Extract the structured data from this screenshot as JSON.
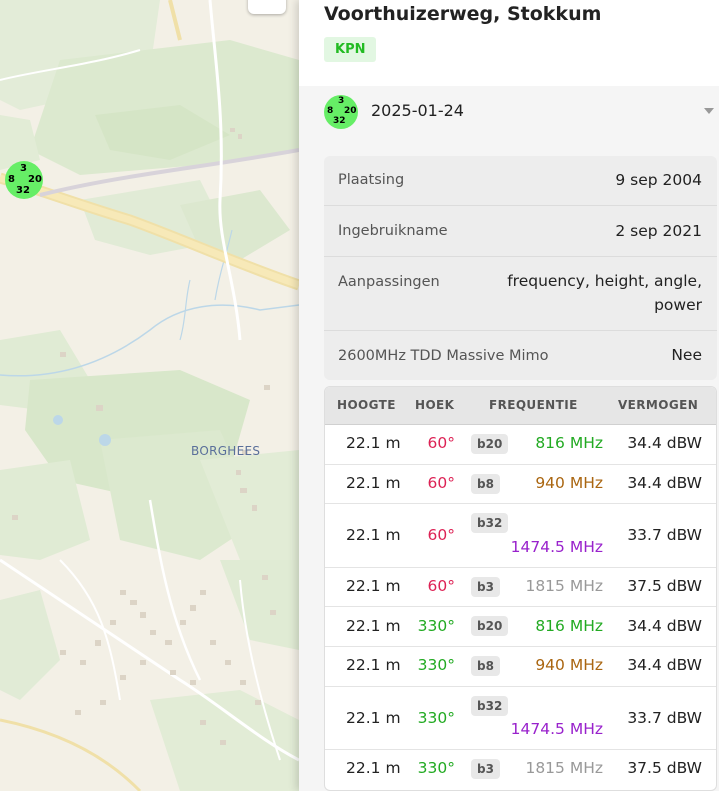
{
  "colors": {
    "green": "#22aa22",
    "red": "#dd2255",
    "brown": "#aa6611",
    "purple": "#9922cc",
    "gray": "#999999",
    "marker": "#66ee66"
  },
  "map": {
    "layers_icon": "layers-icon",
    "cluster": {
      "top": "3",
      "left": "8",
      "right": "20",
      "bottom": "32"
    },
    "label": "BORGHEES"
  },
  "site": {
    "title": "Voorthuizerweg, Stokkum",
    "operator": "KPN",
    "date_icon": {
      "top": "3",
      "left": "8",
      "right": "20",
      "bottom": "32"
    },
    "date": "2025-01-24"
  },
  "info": [
    {
      "label": "Plaatsing",
      "value": "9 sep 2004"
    },
    {
      "label": "Ingebruikname",
      "value": "2 sep 2021"
    },
    {
      "label": "Aanpassingen",
      "value": "frequency, height, angle, power"
    },
    {
      "label": "2600MHz TDD Massive Mimo",
      "value": "Nee"
    }
  ],
  "table": {
    "headers": {
      "height": "HOOGTE",
      "angle": "HOEK",
      "frequency": "FREQUENTIE",
      "power": "VERMOGEN"
    },
    "rows": [
      {
        "height": "22.1 m",
        "angle": "60°",
        "band": "b20",
        "freq": "816 MHz",
        "power": "34.4 dBW"
      },
      {
        "height": "22.1 m",
        "angle": "60°",
        "band": "b8",
        "freq": "940 MHz",
        "power": "34.4 dBW"
      },
      {
        "height": "22.1 m",
        "angle": "60°",
        "band": "b32",
        "freq": "1474.5 MHz",
        "power": "33.7 dBW"
      },
      {
        "height": "22.1 m",
        "angle": "60°",
        "band": "b3",
        "freq": "1815 MHz",
        "power": "37.5 dBW"
      },
      {
        "height": "22.1 m",
        "angle": "330°",
        "band": "b20",
        "freq": "816 MHz",
        "power": "34.4 dBW"
      },
      {
        "height": "22.1 m",
        "angle": "330°",
        "band": "b8",
        "freq": "940 MHz",
        "power": "34.4 dBW"
      },
      {
        "height": "22.1 m",
        "angle": "330°",
        "band": "b32",
        "freq": "1474.5 MHz",
        "power": "33.7 dBW"
      },
      {
        "height": "22.1 m",
        "angle": "330°",
        "band": "b3",
        "freq": "1815 MHz",
        "power": "37.5 dBW"
      }
    ]
  }
}
